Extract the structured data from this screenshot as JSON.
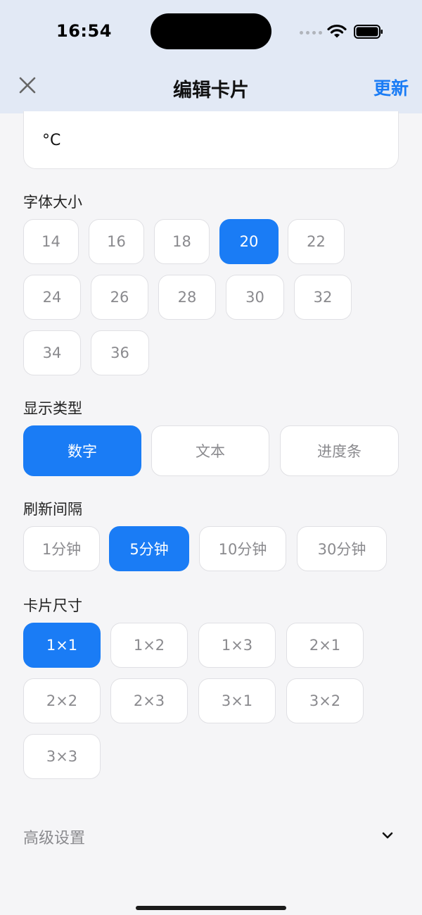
{
  "status_bar": {
    "time": "16:54"
  },
  "nav": {
    "title": "编辑卡片",
    "update_label": "更新",
    "close_icon": "close-icon"
  },
  "unit_field": {
    "value": "°C"
  },
  "font_size": {
    "label": "字体大小",
    "options": [
      "14",
      "16",
      "18",
      "20",
      "22",
      "24",
      "26",
      "28",
      "30",
      "32",
      "34",
      "36"
    ],
    "selected": "20"
  },
  "display_type": {
    "label": "显示类型",
    "options": [
      "数字",
      "文本",
      "进度条"
    ],
    "selected": "数字"
  },
  "refresh_interval": {
    "label": "刷新间隔",
    "options": [
      "1分钟",
      "5分钟",
      "10分钟",
      "30分钟"
    ],
    "selected": "5分钟"
  },
  "card_size": {
    "label": "卡片尺寸",
    "options": [
      "1×1",
      "1×2",
      "1×3",
      "2×1",
      "2×2",
      "2×3",
      "3×1",
      "3×2",
      "3×3"
    ],
    "selected": "1×1"
  },
  "advanced": {
    "label": "高级设置",
    "icon": "chevron-down-icon"
  },
  "colors": {
    "accent": "#1a7cf5",
    "nav_bg": "#e2e9f5",
    "page_bg": "#f5f5f7"
  }
}
